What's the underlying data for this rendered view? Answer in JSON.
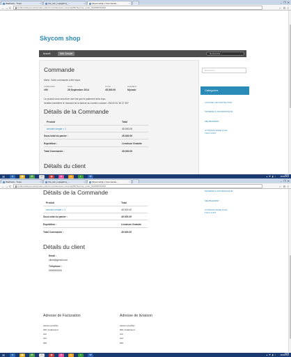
{
  "browser": {
    "tabs": [
      {
        "label": "WebFaza - Tutsa"
      },
      {
        "label": "Clé_sdc_mujagdtmy_..."
      },
      {
        "label": "Skycomshop | Commande..."
      },
      {
        "label": ""
      }
    ],
    "tabs_shot2": [
      {
        "label": "WebFaza - Tutsa"
      },
      {
        "label": "Clé_sdc_mujagdtmy_..."
      },
      {
        "label": "Skycomshop | Commande..."
      },
      {
        "label": ""
      }
    ],
    "url": "localhost/skycomshop/index.php/commande/order-received/83/?key=wc_order_54280004f2b94",
    "url_shot2": "localhost/skycomshop/index.php/commande/order-received/83/?key=wc_order_54280004f2b94",
    "window_controls": [
      "–",
      "❐",
      "✕"
    ],
    "nav_icons": [
      "←",
      "→",
      "C"
    ],
    "right_icons": [
      "☆",
      "⚙",
      "≡"
    ]
  },
  "site": {
    "title": "Skycom shop",
    "nav": [
      {
        "label": "Accueil"
      },
      {
        "label": "Mon Compte"
      }
    ],
    "nav_search_placeholder": "Rechercher ...",
    "sidebar": {
      "search_placeholder": "Recherche ...",
      "heading": "Catégories",
      "items": [
        "LOGICIEL DE PROTECTION",
        "MATERIELS INFORMATIQUE",
        "MEUBLEMENT",
        "UTITESTE MADE PLAN TOUT JUST"
      ]
    }
  },
  "order": {
    "heading": "Commande",
    "thanks": "Merci. Votre commande a été reçue.",
    "meta_labels": [
      "COMMANDE :",
      "DATE :",
      "TOTAL :",
      "PAIEMENT :"
    ],
    "meta_values": [
      "#90",
      "28 Septembre 2014",
      "45.000.00",
      "Mycash"
    ],
    "note1": "Le produit vous sera livré une fois que le paiement sera reçu.",
    "note2": "Veuillez transférer le montant de la facture au numéro suivant : 06240 81 35 27 357"
  },
  "details": {
    "heading": "Détails de la Commande",
    "col_product": "Produit",
    "col_total": "Total",
    "rows": [
      {
        "label": "armoire simple × 1",
        "value": "45.000.00"
      },
      {
        "label": "Sous-total du panier :",
        "value": "45.000.00"
      },
      {
        "label": "Expédition :",
        "value": "Livraison Gratuite"
      },
      {
        "label": "Total Commande :",
        "value": "45.000.00"
      }
    ]
  },
  "client": {
    "heading": "Détails du client",
    "email_label": "Email :",
    "email_value": "client@gmail.com",
    "phone_label": "Téléphone :",
    "phone_value": "0000000000"
  },
  "billing": {
    "heading": "Adresse de Facturation",
    "lines": [
      "sassan jonathan",
      "000, bodarisaud",
      "test",
      "test",
      "000"
    ]
  },
  "shipping": {
    "heading": "Adresse de livraison",
    "lines": [
      "sassan jonathan",
      "000, bodarisaud",
      "test",
      "test",
      "000"
    ]
  },
  "taskbar": {
    "start": "⊞",
    "apps": [
      "e",
      "▦",
      "⊞",
      "♪",
      "◉",
      "⊛",
      "⊙",
      "◐",
      "W"
    ],
    "tray": [
      "▴",
      "⚑",
      "▮",
      "♪"
    ],
    "time": "13:03",
    "date": "28/09/2014",
    "time_shot2": "13:04",
    "date_shot2": "28/09/2014"
  }
}
